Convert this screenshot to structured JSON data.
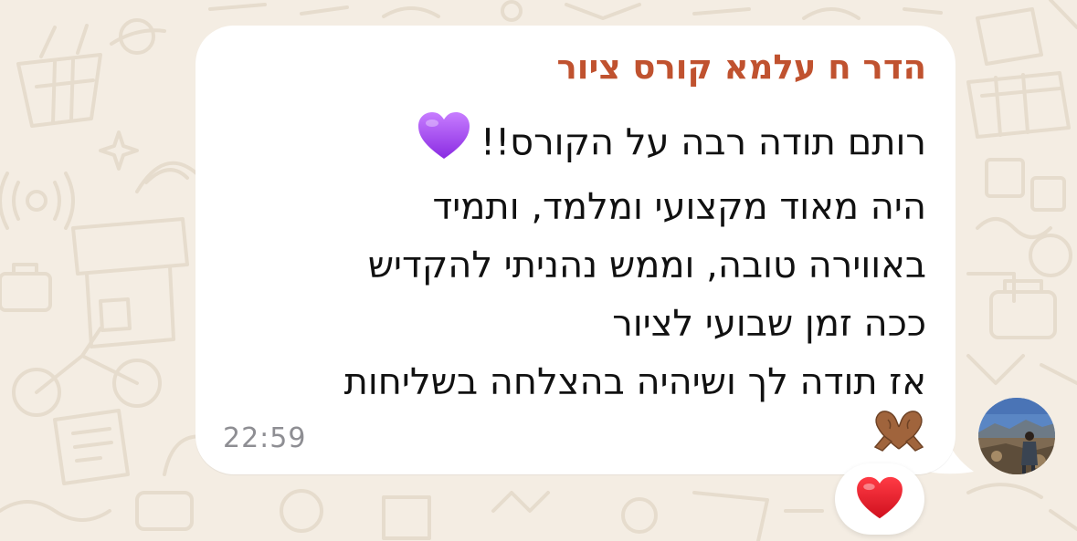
{
  "chat": {
    "sender_name": "הדר ח עלמא קורס ציור",
    "sender_color": "#c0522f",
    "message_lines": [
      "רותם תודה רבה על הקורס!!",
      "היה מאוד מקצועי ומלמד, ותמיד",
      "באווירה טובה, וממש נהניתי להקדיש",
      "ככה זמן שבועי לציור",
      "אז תודה לך ושיהיה בהצלחה בשליחות"
    ],
    "inline_emoji": "purple-heart-icon",
    "trailing_emoji": "heart-hands-icon",
    "timestamp": "22:59",
    "reaction": "red-heart-icon"
  },
  "colors": {
    "wallpaper": "#f4ede3",
    "bubble": "#ffffff",
    "purple_heart": "#a64ee8",
    "red_heart": "#e0202e",
    "timestamp": "#8e8e93"
  }
}
